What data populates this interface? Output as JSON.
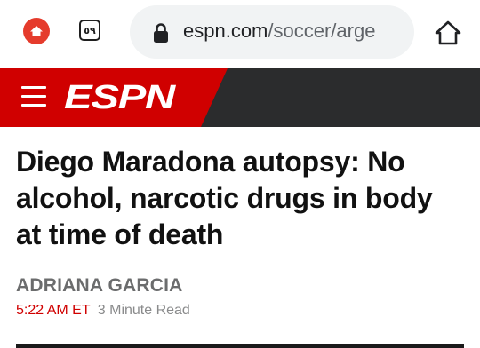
{
  "browser": {
    "tab_count": "٥٩",
    "url_host": "espn.com",
    "url_path": "/soccer/arge",
    "icons": {
      "home_app": "brave-home-icon",
      "lock": "lock-icon",
      "home": "home-icon"
    },
    "colors": {
      "accent": "#e53b2c",
      "pill": "#f1f3f4"
    }
  },
  "header": {
    "logo_text": "ESPN",
    "brand_red": "#d00000",
    "bar_color": "#2b2c2d"
  },
  "article": {
    "headline": "Diego Maradona autopsy: No alcohol, narcotic drugs in body at time of death",
    "author": "ADRIANA GARCIA",
    "time": "5:22 AM ET",
    "read_time": "3 Minute Read"
  }
}
